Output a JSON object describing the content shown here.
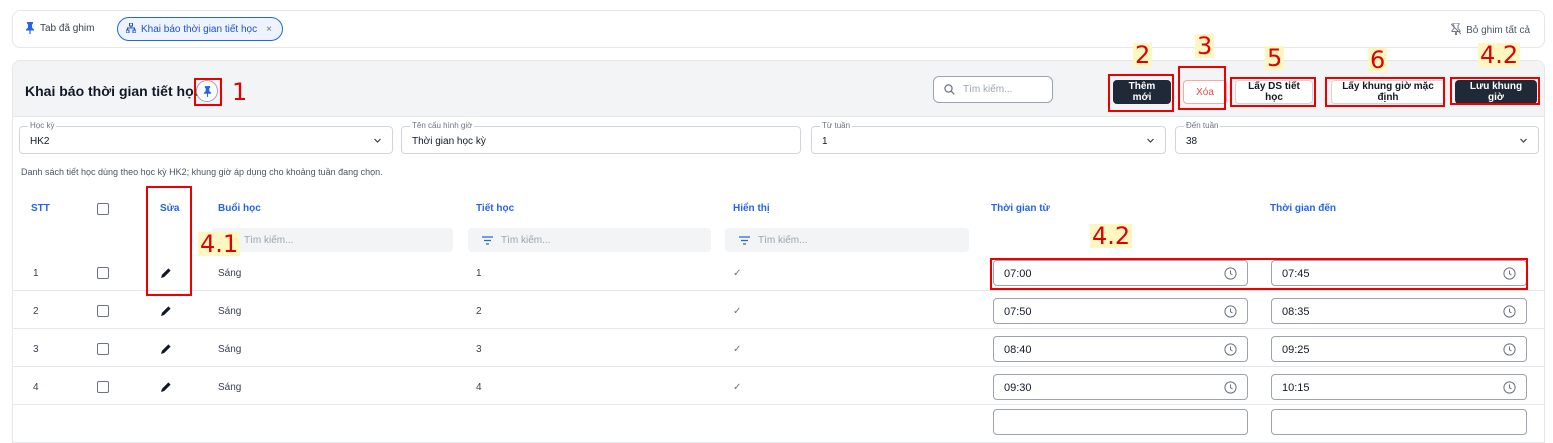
{
  "tabbar": {
    "pinned_label": "Tab đã ghim",
    "active_tab": "Khai báo thời gian tiết học",
    "close_symbol": "×",
    "unpin_all": "Bỏ ghim tất cả"
  },
  "header": {
    "title": "Khai báo thời gian tiết học",
    "search_placeholder": "Tìm kiếm...",
    "buttons": {
      "add": "Thêm mới",
      "delete": "Xóa",
      "get_periods": "Lấy DS tiết học",
      "get_default": "Lấy khung giờ mặc định",
      "save": "Lưu khung giờ"
    }
  },
  "filters": {
    "semester": {
      "label": "Học kỳ",
      "value": "HK2"
    },
    "config_name": {
      "label": "Tên cấu hình giờ",
      "value": "Thời gian học kỳ"
    },
    "from_week": {
      "label": "Từ tuần",
      "value": "1"
    },
    "to_week": {
      "label": "Đến tuần",
      "value": "38"
    }
  },
  "note": "Danh sách tiết học dùng theo học kỳ HK2; khung giờ áp dụng cho khoảng tuần đang chọn.",
  "table": {
    "headers": {
      "stt": "STT",
      "edit": "Sửa",
      "session": "Buổi học",
      "period": "Tiết học",
      "display": "Hiển thị",
      "time_from": "Thời gian từ",
      "time_to": "Thời gian đến"
    },
    "search_placeholder": "Tìm kiếm...",
    "rows": [
      {
        "stt": "1",
        "session": "Sáng",
        "period": "1",
        "display": "✓",
        "from": "07:00",
        "to": "07:45"
      },
      {
        "stt": "2",
        "session": "Sáng",
        "period": "2",
        "display": "✓",
        "from": "07:50",
        "to": "08:35"
      },
      {
        "stt": "3",
        "session": "Sáng",
        "period": "3",
        "display": "✓",
        "from": "08:40",
        "to": "09:25"
      },
      {
        "stt": "4",
        "session": "Sáng",
        "period": "4",
        "display": "✓",
        "from": "09:30",
        "to": "10:15"
      }
    ]
  },
  "annotations": {
    "a1": "1",
    "a2": "2",
    "a3": "3",
    "a5": "5",
    "a6": "6",
    "a42_top": "4.2",
    "a41": "4.1",
    "a42_mid": "4.2"
  },
  "colors": {
    "accent": "#2563eb",
    "dark_button": "#1f2937",
    "danger": "#ef4444",
    "annotation": "#e00000"
  }
}
